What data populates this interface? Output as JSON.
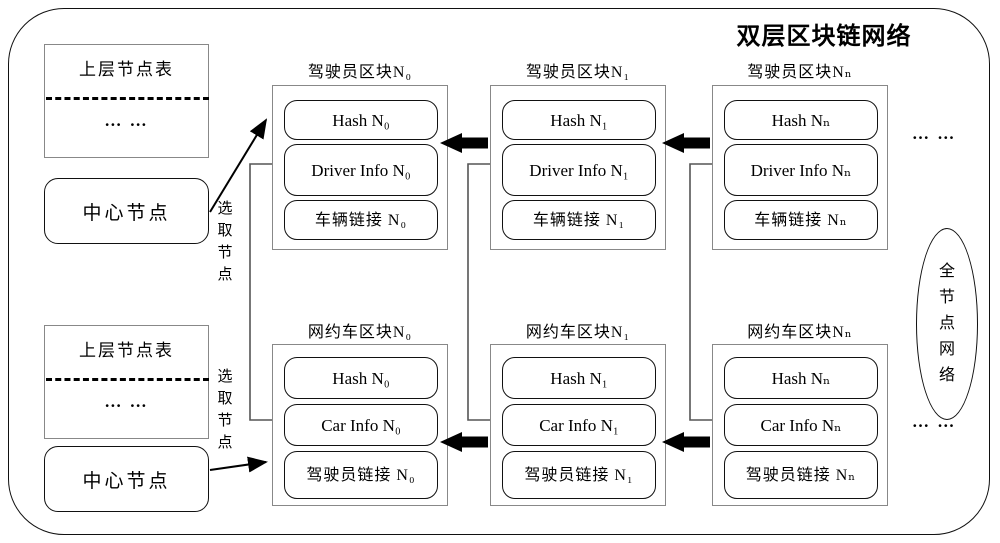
{
  "diagram": {
    "title": "双层区块链网络",
    "ellipsis": "… …"
  },
  "left_panels": [
    {
      "table_title": "上层节点表",
      "table_dots": "… …",
      "center_node": "中心节点",
      "select_label": [
        "选",
        "取",
        "节",
        "点"
      ]
    },
    {
      "table_title": "上层节点表",
      "table_dots": "… …",
      "center_node": "中心节点",
      "select_label": [
        "选",
        "取",
        "节",
        "点"
      ]
    }
  ],
  "driver_chain": {
    "caption_prefix": "驾驶员区块",
    "blocks": [
      {
        "caption": "驾驶员区块N₀",
        "fields": [
          "Hash N₀",
          "Driver Info N₀",
          "车辆链接 N₀"
        ]
      },
      {
        "caption": "驾驶员区块N₁",
        "fields": [
          "Hash N₁",
          "Driver Info N₁",
          "车辆链接 N₁"
        ]
      },
      {
        "caption": "驾驶员区块Nₙ",
        "fields": [
          "Hash Nₙ",
          "Driver Info Nₙ",
          "车辆链接 Nₙ"
        ]
      }
    ],
    "trailing_dots": "… …"
  },
  "car_chain": {
    "caption_prefix": "网约车区块",
    "blocks": [
      {
        "caption": "网约车区块N₀",
        "fields": [
          "Hash N₀",
          "Car Info N₀",
          "驾驶员链接 N₀"
        ]
      },
      {
        "caption": "网约车区块N₁",
        "fields": [
          "Hash N₁",
          "Car Info N₁",
          "驾驶员链接 N₁"
        ]
      },
      {
        "caption": "网约车区块Nₙ",
        "fields": [
          "Hash Nₙ",
          "Car Info Nₙ",
          "驾驶员链接 Nₙ"
        ]
      }
    ],
    "trailing_dots": "… …"
  },
  "full_node_network": {
    "chars": [
      "全",
      "节",
      "点",
      "网",
      "络"
    ]
  },
  "colors": {
    "stroke": "#111111",
    "box_stroke": "#888888",
    "background": "#ffffff",
    "arrow": "#000000"
  }
}
